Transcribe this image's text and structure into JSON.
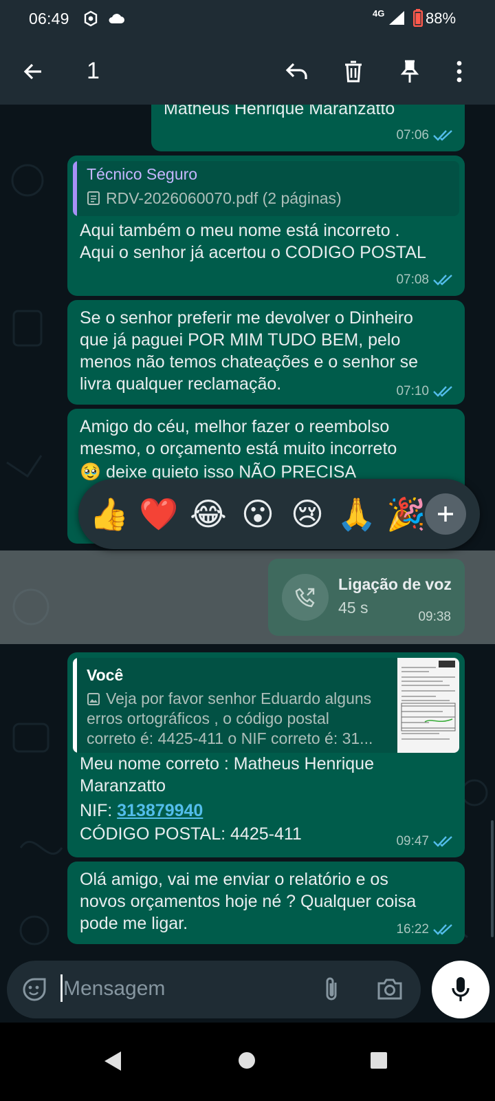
{
  "status": {
    "time": "06:49",
    "network": "4G",
    "battery": "88%"
  },
  "selection": {
    "count": "1"
  },
  "messages": {
    "m1": {
      "text": "Matheus Henrique Maranzatto",
      "time": "07:06"
    },
    "m2": {
      "quote_author": "Técnico Seguro",
      "quote_text": "RDV-2026060070.pdf (2 páginas)",
      "lines": [
        "Aqui também o meu nome está incorreto .",
        "Aqui o senhor já acertou o CODIGO POSTAL"
      ],
      "time": "07:08"
    },
    "m3": {
      "lines": [
        "Se o senhor preferir me devolver o Dinheiro",
        "que já paguei POR MIM TUDO BEM, pelo",
        "menos não temos chateações e o senhor se",
        "livra qualquer reclamação."
      ],
      "time": "07:10"
    },
    "m4": {
      "lines": [
        "Amigo do céu, melhor fazer o reembolso",
        "mesmo, o orçamento está muito incorreto",
        "🥹 deixe quieto isso NÃO PRECISA"
      ]
    },
    "call": {
      "title": "Ligação de voz",
      "duration": "45 s",
      "time": "09:38"
    },
    "m5": {
      "quote_author": "Você",
      "quote_lines": [
        "Veja por favor senhor Eduardo alguns",
        "erros ortográficos , o código postal",
        "correto é: 4425-411 o NIF correto é: 31..."
      ],
      "line1": "Meu nome correto : Matheus Henrique",
      "line2": "Maranzatto",
      "nif_label": "NIF: ",
      "nif_value": "313879940",
      "line4": "CÓDIGO POSTAL: 4425-411",
      "time": "09:47"
    },
    "m6": {
      "lines": [
        "Olá amigo, vai me enviar o relatório e os",
        "novos orçamentos hoje né ? Qualquer coisa",
        "pode me ligar."
      ],
      "time": "16:22"
    }
  },
  "reactions": [
    "👍",
    "❤️",
    "😂",
    "😮",
    "😢",
    "🙏",
    "🎉"
  ],
  "composer": {
    "placeholder": "Mensagem"
  },
  "icons": {
    "back": "arrow-left-icon",
    "reply": "reply-icon",
    "delete": "trash-icon",
    "pin": "pin-icon",
    "more": "more-vert-icon",
    "double_check": "double-check-icon",
    "emoji": "sticker-icon",
    "attach": "paperclip-icon",
    "camera": "camera-icon",
    "mic": "mic-icon"
  },
  "colors": {
    "bubble_out": "#005c4b",
    "quote_bar_1": "#a791f7",
    "quote_bar_2": "#ffffff",
    "read_ticks": "#53bdeb",
    "link": "#53bdeb",
    "header_bg": "#1f2c34"
  }
}
